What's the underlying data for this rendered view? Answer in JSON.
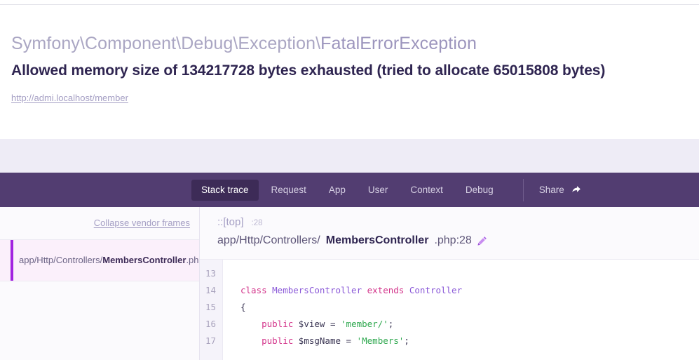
{
  "exception": {
    "namespace": "Symfony\\Component\\Debug\\Exception\\",
    "class_short": "FatalErrorException",
    "message": "Allowed memory size of 134217728 bytes exhausted (tried to allocate 65015808 bytes)",
    "url": "http://admi.localhost/member"
  },
  "nav": {
    "tabs": [
      {
        "label": "Stack trace",
        "active": true
      },
      {
        "label": "Request",
        "active": false
      },
      {
        "label": "App",
        "active": false
      },
      {
        "label": "User",
        "active": false
      },
      {
        "label": "Context",
        "active": false
      },
      {
        "label": "Debug",
        "active": false
      }
    ],
    "share_label": "Share",
    "share_icon": "share-arrow-icon"
  },
  "sidebar": {
    "collapse_label": "Collapse vendor frames",
    "frames": [
      {
        "dir": "app/Http/Controllers/",
        "name": "MembersController",
        "ext": ".php",
        "active": true
      }
    ]
  },
  "frame_detail": {
    "function": "::[top]",
    "line_badge": ":28",
    "file_dir": "app/Http/Controllers/",
    "file_name": "MembersController",
    "file_ext": ".php:28",
    "edit_icon": "pencil-icon"
  },
  "code": {
    "line_numbers": [
      "13",
      "14",
      "15",
      "16",
      "17"
    ],
    "lines": [
      [],
      [
        {
          "t": "class ",
          "c": "tok-kw"
        },
        {
          "t": "MembersController ",
          "c": "tok-cls"
        },
        {
          "t": "extends ",
          "c": "tok-kw"
        },
        {
          "t": "Controller",
          "c": "tok-cls"
        }
      ],
      [
        {
          "t": "{",
          "c": "tok-pun"
        }
      ],
      [
        {
          "t": "    public ",
          "c": "tok-kw"
        },
        {
          "t": "$view",
          "c": "tok-var"
        },
        {
          "t": " = ",
          "c": "tok-pun"
        },
        {
          "t": "'member/'",
          "c": "tok-str"
        },
        {
          "t": ";",
          "c": "tok-pun"
        }
      ],
      [
        {
          "t": "    public ",
          "c": "tok-kw"
        },
        {
          "t": "$msgName",
          "c": "tok-var"
        },
        {
          "t": " = ",
          "c": "tok-pun"
        },
        {
          "t": "'Members'",
          "c": "tok-str"
        },
        {
          "t": ";",
          "c": "tok-pun"
        }
      ]
    ]
  },
  "colors": {
    "nav_bg": "#523d71",
    "nav_active_bg": "#3d2b57",
    "band_bg": "#eeecf6",
    "accent_purple": "#a223e0",
    "message_color": "#2f2551",
    "muted_purple": "#a59fc4"
  }
}
